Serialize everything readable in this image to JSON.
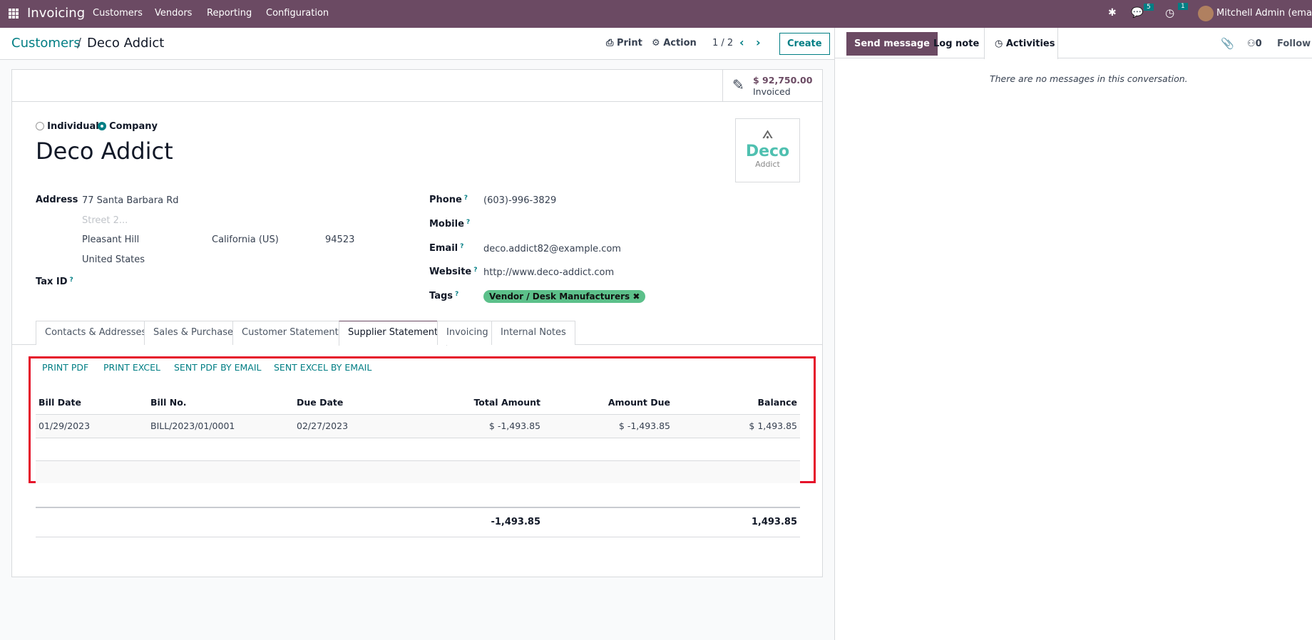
{
  "navbar": {
    "app": "Invoicing",
    "menu": [
      "Customers",
      "Vendors",
      "Reporting",
      "Configuration"
    ],
    "messages_count": "5",
    "activities_count": "1",
    "user": "Mitchell Admin (email)"
  },
  "control_panel": {
    "breadcrumb_parent": "Customers",
    "breadcrumb_current": "Deco Addict",
    "print": "Print",
    "action": "Action",
    "pager": "1 / 2",
    "create": "Create"
  },
  "stat_button": {
    "value": "$ 92,750.00",
    "label": "Invoiced"
  },
  "form": {
    "type_options": [
      "Individual",
      "Company"
    ],
    "type_selected": "Company",
    "name": "Deco Addict",
    "logo": {
      "title": "Deco",
      "subtitle": "Addict"
    },
    "address_label": "Address",
    "street": "77 Santa Barbara Rd",
    "street2_placeholder": "Street 2...",
    "city": "Pleasant Hill",
    "state": "California (US)",
    "zip": "94523",
    "country": "United States",
    "tax_id_label": "Tax ID",
    "phone_label": "Phone",
    "phone": "(603)-996-3829",
    "mobile_label": "Mobile",
    "email_label": "Email",
    "email": "deco.addict82@example.com",
    "website_label": "Website",
    "website": "http://www.deco-addict.com",
    "tags_label": "Tags",
    "tag": "Vendor / Desk Manufacturers",
    "help_mark": "?"
  },
  "tabs": [
    "Contacts & Addresses",
    "Sales & Purchase",
    "Customer Statement",
    "Supplier Statement",
    "Invoicing",
    "Internal Notes"
  ],
  "active_tab": "Supplier Statement",
  "statement": {
    "actions": [
      "PRINT PDF",
      "PRINT EXCEL",
      "SENT PDF BY EMAIL",
      "SENT EXCEL BY EMAIL"
    ],
    "columns": [
      "Bill Date",
      "Bill No.",
      "Due Date",
      "Total Amount",
      "Amount Due",
      "Balance"
    ],
    "rows": [
      [
        "01/29/2023",
        "BILL/2023/01/0001",
        "02/27/2023",
        "$ -1,493.85",
        "$ -1,493.85",
        "$ 1,493.85"
      ]
    ],
    "totals": {
      "total_amount": "-1,493.85",
      "balance": "1,493.85"
    },
    "highlight_color": "#e5122a"
  },
  "chatter": {
    "send_message": "Send message",
    "log_note": "Log note",
    "activities": "Activities",
    "followers_count": "0",
    "follow": "Follow",
    "empty": "There are no messages in this conversation."
  }
}
